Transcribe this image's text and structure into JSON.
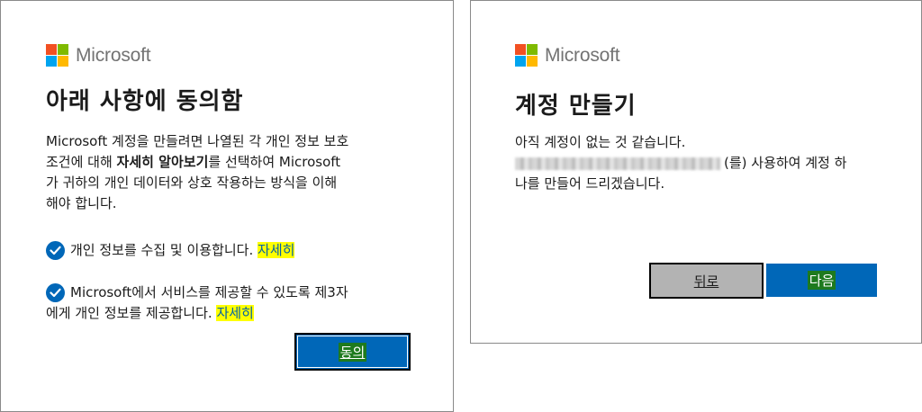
{
  "left_dialog": {
    "brand": "Microsoft",
    "title": "아래 사항에 동의함",
    "intro_lines": [
      "Microsoft 계정을 만들려면 나열된 각 개인 정보 보호",
      "조건에 대해 ",
      "자세히 알아보기",
      "를 선택하여 Microsoft",
      "가 귀하의 개인 데이터와 상호 작용하는 방식을 이해",
      "해야 합니다."
    ],
    "consent_1_text": "개인 정보를 수집 및 이용합니다. ",
    "consent_1_link": "자세히",
    "consent_2_line1": "Microsoft에서 서비스를 제공할 수 있도록 제3자",
    "consent_2_line2": "에게 개인 정보를 제공합니다. ",
    "consent_2_link": "자세히",
    "agree_button": "동의"
  },
  "right_dialog": {
    "brand": "Microsoft",
    "title": "계정 만들기",
    "line1": "아직 계정이 없는 것 같습니다.",
    "line2_suffix": "(를) 사용하여 계정 하",
    "line3": "나를 만들어 드리겠습니다.",
    "back_button": "뒤로",
    "next_button": "다음"
  },
  "colors": {
    "accent": "#0067b8",
    "highlight": "#ffff00",
    "logo_red": "#f25022",
    "logo_green": "#7fba00",
    "logo_blue": "#00a4ef",
    "logo_yellow": "#ffb900"
  }
}
